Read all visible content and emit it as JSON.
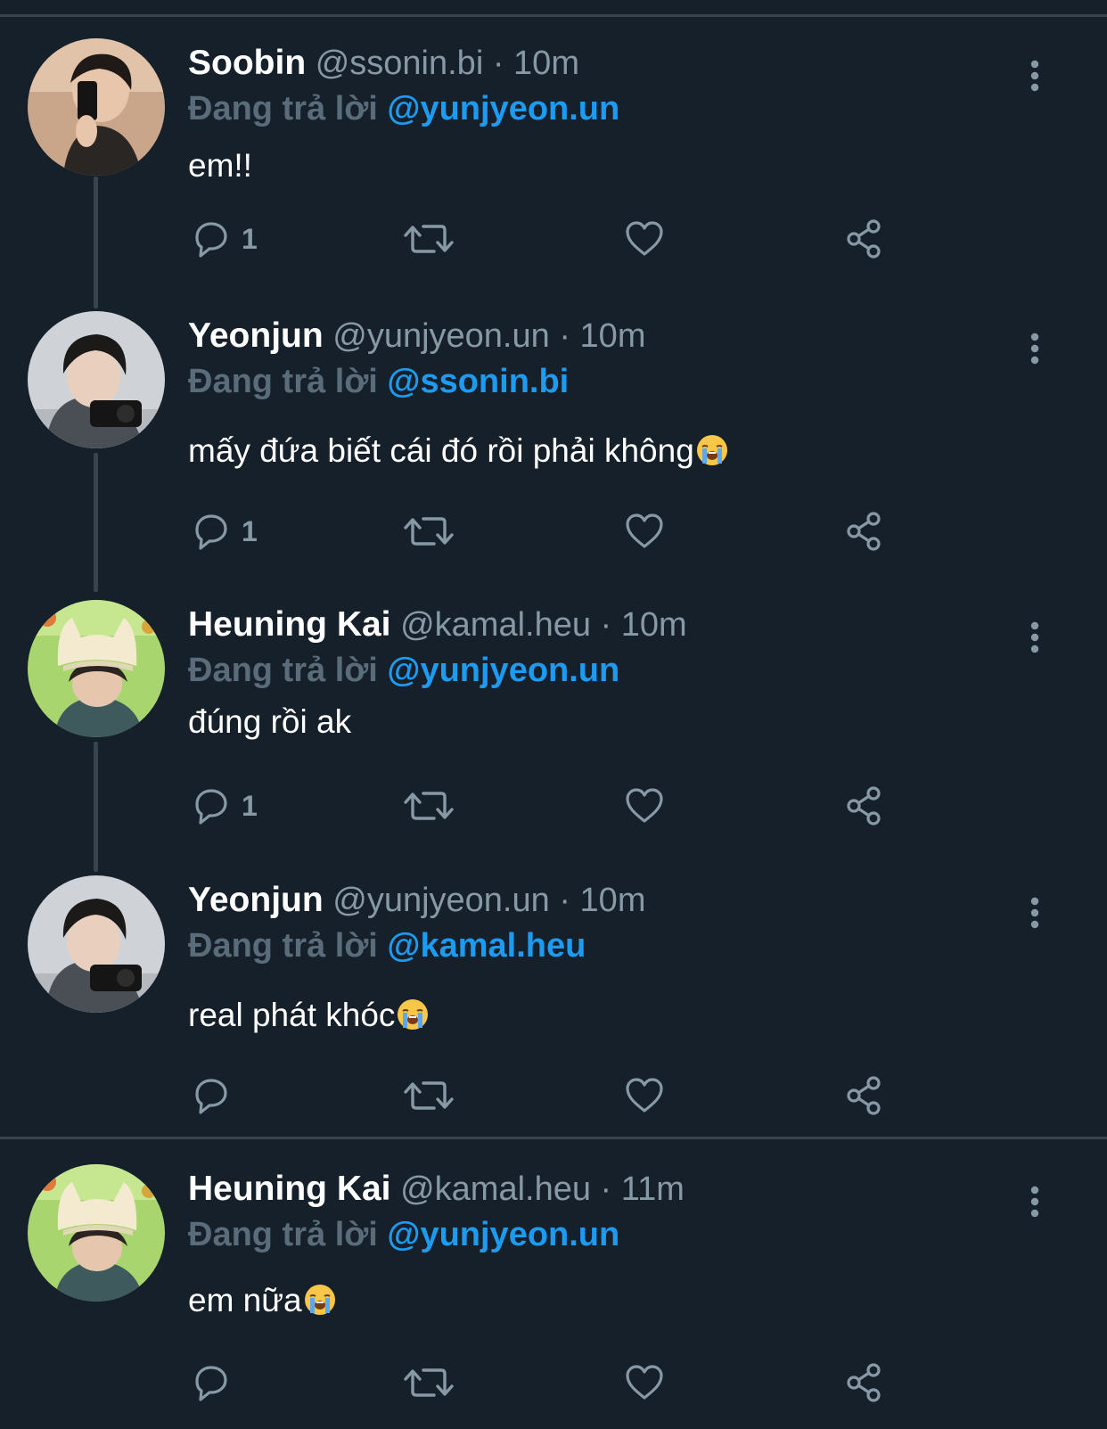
{
  "theme": {
    "background": "#15202b",
    "divider": "#38444d",
    "secondary_text": "#8899a6",
    "link": "#1d9bf0"
  },
  "replying_prefix": "Đang trả lời",
  "separator": "·",
  "tweets": [
    {
      "name": "Soobin",
      "handle": "@ssonin.bi",
      "time": "10m",
      "replying_to": "@yunjyeon.un",
      "text": "em!!",
      "emoji": "",
      "reply_count": "1",
      "avatar": "soobin-avatar"
    },
    {
      "name": "Yeonjun",
      "handle": "@yunjyeon.un",
      "time": "10m",
      "replying_to": "@ssonin.bi",
      "text": "mấy đứa biết cái đó rồi phải không",
      "emoji": "loudly-crying-face",
      "reply_count": "1",
      "avatar": "yeonjun-avatar"
    },
    {
      "name": "Heuning Kai",
      "handle": "@kamal.heu",
      "time": "10m",
      "replying_to": "@yunjyeon.un",
      "text": "đúng rồi ak",
      "emoji": "",
      "reply_count": "1",
      "avatar": "heuningkai-avatar"
    },
    {
      "name": "Yeonjun",
      "handle": "@yunjyeon.un",
      "time": "10m",
      "replying_to": "@kamal.heu",
      "text": "real phát khóc",
      "emoji": "loudly-crying-face",
      "reply_count": "",
      "avatar": "yeonjun-avatar"
    },
    {
      "name": "Heuning Kai",
      "handle": "@kamal.heu",
      "time": "11m",
      "replying_to": "@yunjyeon.un",
      "text": "em nữa",
      "emoji": "loudly-crying-face",
      "reply_count": "",
      "avatar": "heuningkai-avatar"
    }
  ]
}
